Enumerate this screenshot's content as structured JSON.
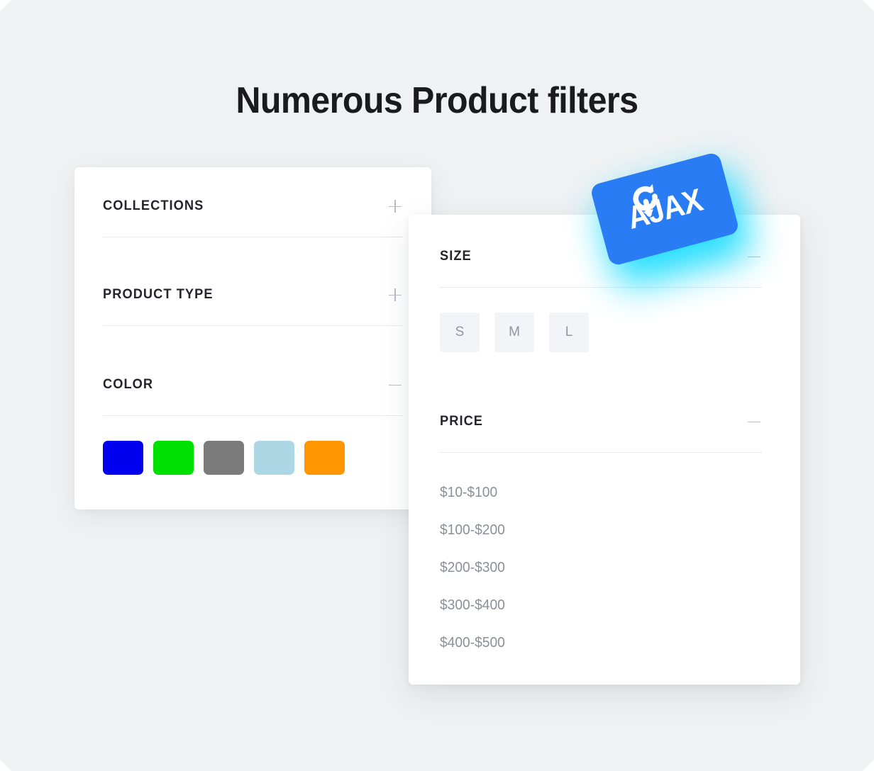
{
  "page": {
    "title": "Numerous Product filters",
    "background_color": "#f0f1f3"
  },
  "badge": {
    "label": "AJAX",
    "icon": "refresh-circular-arrow-icon",
    "background_color": "#2a7cf5",
    "glow_color": "#17dcff",
    "text_color": "#ffffff"
  },
  "left_panel": {
    "groups": [
      {
        "title": "COLLECTIONS",
        "toggle": "+",
        "expanded": false
      },
      {
        "title": "PRODUCT TYPE",
        "toggle": "+",
        "expanded": false
      },
      {
        "title": "COLOR",
        "toggle": "−",
        "expanded": true
      }
    ],
    "colors": [
      {
        "name": "blue",
        "hex": "#0000ef"
      },
      {
        "name": "green",
        "hex": "#00e000"
      },
      {
        "name": "gray",
        "hex": "#7b7b7b"
      },
      {
        "name": "light-blue",
        "hex": "#aed7e6"
      },
      {
        "name": "orange",
        "hex": "#ff9500"
      }
    ]
  },
  "right_panel": {
    "groups": [
      {
        "title": "SIZE",
        "toggle": "−",
        "expanded": true
      },
      {
        "title": "PRICE",
        "toggle": "−",
        "expanded": true
      }
    ],
    "sizes": [
      "S",
      "M",
      "L"
    ],
    "prices": [
      "$10-$100",
      "$100-$200",
      "$200-$300",
      "$300-$400",
      "$400-$500"
    ]
  }
}
